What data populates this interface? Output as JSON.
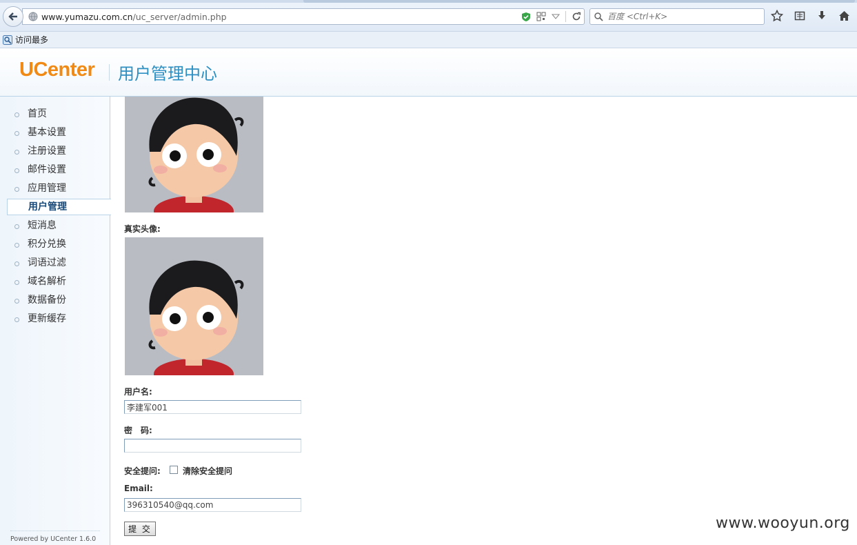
{
  "browser": {
    "url_domain": "www.yumazu.com.cn",
    "url_path": "/uc_server/admin.php",
    "search_placeholder": "百度 <Ctrl+K>",
    "bookmark_label": "访问最多"
  },
  "header": {
    "logo": "UCenter",
    "title": "用户管理中心"
  },
  "sidebar": {
    "items": [
      {
        "label": "首页",
        "active": false
      },
      {
        "label": "基本设置",
        "active": false
      },
      {
        "label": "注册设置",
        "active": false
      },
      {
        "label": "邮件设置",
        "active": false
      },
      {
        "label": "应用管理",
        "active": false
      },
      {
        "label": "用户管理",
        "active": true
      },
      {
        "label": "短消息",
        "active": false
      },
      {
        "label": "积分兑换",
        "active": false
      },
      {
        "label": "词语过滤",
        "active": false
      },
      {
        "label": "域名解析",
        "active": false
      },
      {
        "label": "数据备份",
        "active": false
      },
      {
        "label": "更新缓存",
        "active": false
      }
    ],
    "powered_by": "Powered by UCenter 1.6.0"
  },
  "form": {
    "real_avatar_label": "真实头像:",
    "username_label": "用户名:",
    "username_value": "李建军001",
    "password_label": "密　码:",
    "password_value": "",
    "security_label": "安全提问:",
    "clear_security_label": "清除安全提问",
    "email_label": "Email:",
    "email_value": "396310540@qq.com",
    "submit_label": "提 交"
  },
  "watermark": "www.wooyun.org",
  "colors": {
    "logo_orange": "#f08a14",
    "title_blue": "#2d8fc2",
    "sidebar_bg": "#eef5fb",
    "border_blue": "#b8d2e8"
  }
}
